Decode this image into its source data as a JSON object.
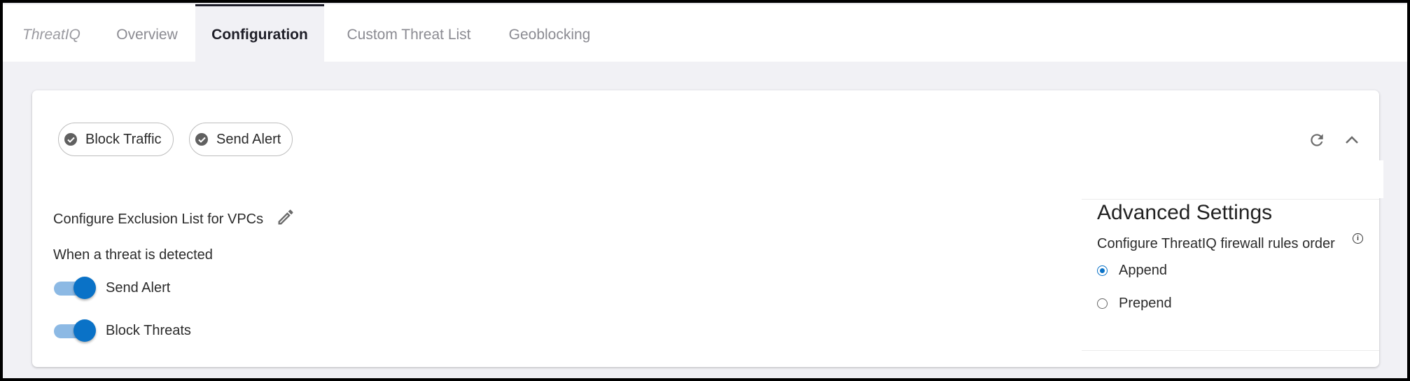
{
  "tabs": {
    "brand": "ThreatIQ",
    "items": [
      {
        "label": "Overview",
        "active": false
      },
      {
        "label": "Configuration",
        "active": true
      },
      {
        "label": "Custom Threat List",
        "active": false
      },
      {
        "label": "Geoblocking",
        "active": false
      }
    ]
  },
  "card": {
    "chips": [
      {
        "label": "Block Traffic",
        "icon": "check-circle-icon"
      },
      {
        "label": "Send Alert",
        "icon": "check-circle-icon"
      }
    ],
    "header_icons": [
      "refresh-icon",
      "chevron-up-icon"
    ],
    "exclusion_label": "Configure Exclusion List for VPCs",
    "exclusion_icon": "pencil-icon",
    "threat_detected_label": "When a threat is detected",
    "toggles": [
      {
        "label": "Send Alert",
        "on": true
      },
      {
        "label": "Block Threats",
        "on": true
      }
    ],
    "advanced": {
      "title": "Advanced Settings",
      "subtitle": "Configure ThreatIQ firewall rules order",
      "info_icon": "info-icon",
      "options": [
        {
          "label": "Append",
          "checked": true
        },
        {
          "label": "Prepend",
          "checked": false
        }
      ]
    }
  },
  "colors": {
    "accent": "#0a72c7",
    "toggle_track": "#8cb9e4",
    "page_bg": "#f1f1f5"
  }
}
